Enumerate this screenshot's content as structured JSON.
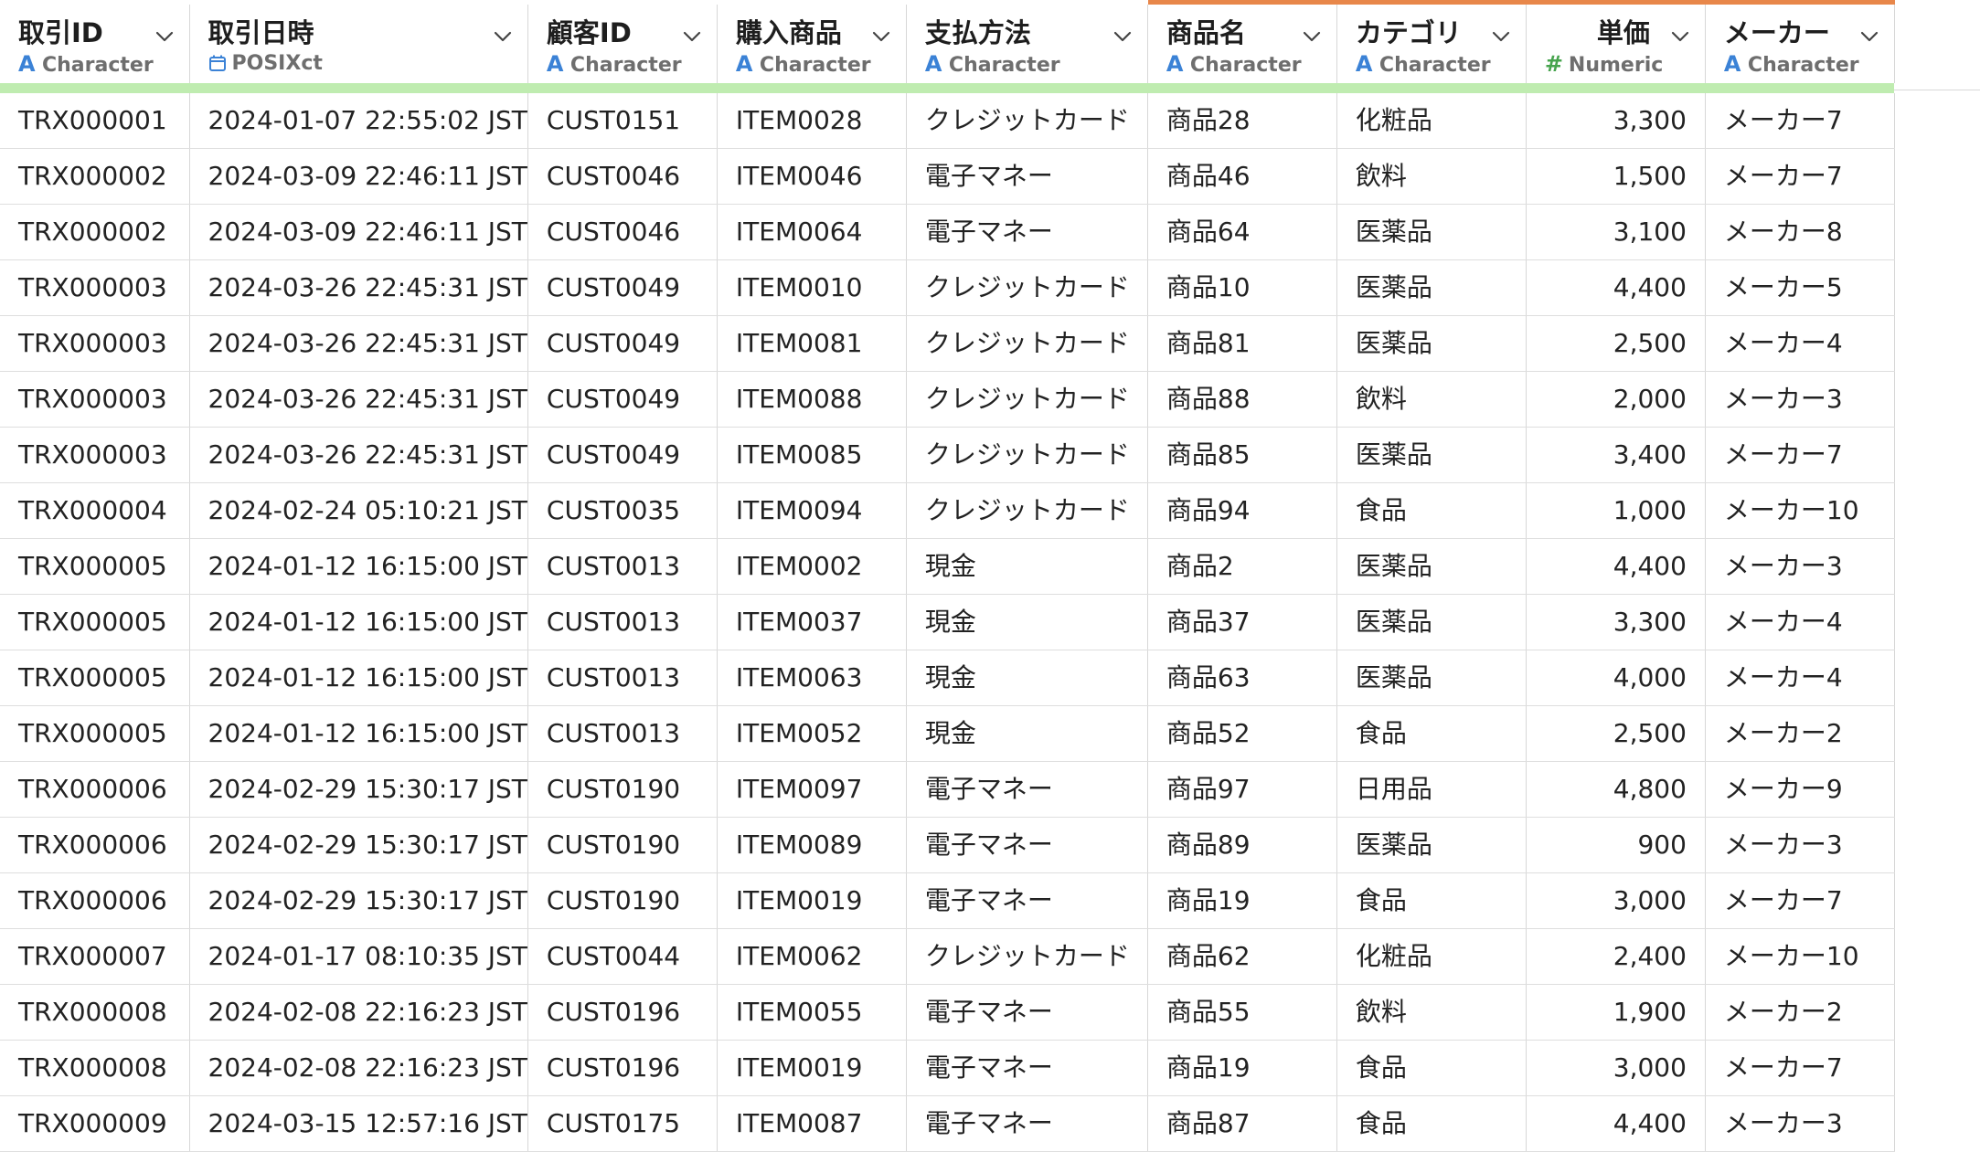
{
  "columns": [
    {
      "name": "取引ID",
      "type": "Character",
      "type_icon": "character-icon",
      "highlight": false,
      "numeric": false
    },
    {
      "name": "取引日時",
      "type": "POSIXct",
      "type_icon": "calendar-icon",
      "highlight": false,
      "numeric": false
    },
    {
      "name": "顧客ID",
      "type": "Character",
      "type_icon": "character-icon",
      "highlight": false,
      "numeric": false
    },
    {
      "name": "購入商品",
      "type": "Character",
      "type_icon": "character-icon",
      "highlight": false,
      "numeric": false
    },
    {
      "name": "支払方法",
      "type": "Character",
      "type_icon": "character-icon",
      "highlight": false,
      "numeric": false
    },
    {
      "name": "商品名",
      "type": "Character",
      "type_icon": "character-icon",
      "highlight": true,
      "numeric": false
    },
    {
      "name": "カテゴリ",
      "type": "Character",
      "type_icon": "character-icon",
      "highlight": true,
      "numeric": false
    },
    {
      "name": "単価",
      "type": "Numeric",
      "type_icon": "hash-icon",
      "highlight": true,
      "numeric": true
    },
    {
      "name": "メーカー",
      "type": "Character",
      "type_icon": "character-icon",
      "highlight": true,
      "numeric": false
    }
  ],
  "colors": {
    "highlight_border": "#e8874a",
    "quality_bar": "#bfecb0",
    "character_icon": "#3b82d6",
    "numeric_icon": "#47a44e"
  },
  "rows": [
    [
      "TRX000001",
      "2024-01-07 22:55:02 JST",
      "CUST0151",
      "ITEM0028",
      "クレジットカード",
      "商品28",
      "化粧品",
      "3,300",
      "メーカー7"
    ],
    [
      "TRX000002",
      "2024-03-09 22:46:11 JST",
      "CUST0046",
      "ITEM0046",
      "電子マネー",
      "商品46",
      "飲料",
      "1,500",
      "メーカー7"
    ],
    [
      "TRX000002",
      "2024-03-09 22:46:11 JST",
      "CUST0046",
      "ITEM0064",
      "電子マネー",
      "商品64",
      "医薬品",
      "3,100",
      "メーカー8"
    ],
    [
      "TRX000003",
      "2024-03-26 22:45:31 JST",
      "CUST0049",
      "ITEM0010",
      "クレジットカード",
      "商品10",
      "医薬品",
      "4,400",
      "メーカー5"
    ],
    [
      "TRX000003",
      "2024-03-26 22:45:31 JST",
      "CUST0049",
      "ITEM0081",
      "クレジットカード",
      "商品81",
      "医薬品",
      "2,500",
      "メーカー4"
    ],
    [
      "TRX000003",
      "2024-03-26 22:45:31 JST",
      "CUST0049",
      "ITEM0088",
      "クレジットカード",
      "商品88",
      "飲料",
      "2,000",
      "メーカー3"
    ],
    [
      "TRX000003",
      "2024-03-26 22:45:31 JST",
      "CUST0049",
      "ITEM0085",
      "クレジットカード",
      "商品85",
      "医薬品",
      "3,400",
      "メーカー7"
    ],
    [
      "TRX000004",
      "2024-02-24 05:10:21 JST",
      "CUST0035",
      "ITEM0094",
      "クレジットカード",
      "商品94",
      "食品",
      "1,000",
      "メーカー10"
    ],
    [
      "TRX000005",
      "2024-01-12 16:15:00 JST",
      "CUST0013",
      "ITEM0002",
      "現金",
      "商品2",
      "医薬品",
      "4,400",
      "メーカー3"
    ],
    [
      "TRX000005",
      "2024-01-12 16:15:00 JST",
      "CUST0013",
      "ITEM0037",
      "現金",
      "商品37",
      "医薬品",
      "3,300",
      "メーカー4"
    ],
    [
      "TRX000005",
      "2024-01-12 16:15:00 JST",
      "CUST0013",
      "ITEM0063",
      "現金",
      "商品63",
      "医薬品",
      "4,000",
      "メーカー4"
    ],
    [
      "TRX000005",
      "2024-01-12 16:15:00 JST",
      "CUST0013",
      "ITEM0052",
      "現金",
      "商品52",
      "食品",
      "2,500",
      "メーカー2"
    ],
    [
      "TRX000006",
      "2024-02-29 15:30:17 JST",
      "CUST0190",
      "ITEM0097",
      "電子マネー",
      "商品97",
      "日用品",
      "4,800",
      "メーカー9"
    ],
    [
      "TRX000006",
      "2024-02-29 15:30:17 JST",
      "CUST0190",
      "ITEM0089",
      "電子マネー",
      "商品89",
      "医薬品",
      "900",
      "メーカー3"
    ],
    [
      "TRX000006",
      "2024-02-29 15:30:17 JST",
      "CUST0190",
      "ITEM0019",
      "電子マネー",
      "商品19",
      "食品",
      "3,000",
      "メーカー7"
    ],
    [
      "TRX000007",
      "2024-01-17 08:10:35 JST",
      "CUST0044",
      "ITEM0062",
      "クレジットカード",
      "商品62",
      "化粧品",
      "2,400",
      "メーカー10"
    ],
    [
      "TRX000008",
      "2024-02-08 22:16:23 JST",
      "CUST0196",
      "ITEM0055",
      "電子マネー",
      "商品55",
      "飲料",
      "1,900",
      "メーカー2"
    ],
    [
      "TRX000008",
      "2024-02-08 22:16:23 JST",
      "CUST0196",
      "ITEM0019",
      "電子マネー",
      "商品19",
      "食品",
      "3,000",
      "メーカー7"
    ],
    [
      "TRX000009",
      "2024-03-15 12:57:16 JST",
      "CUST0175",
      "ITEM0087",
      "電子マネー",
      "商品87",
      "食品",
      "4,400",
      "メーカー3"
    ]
  ]
}
